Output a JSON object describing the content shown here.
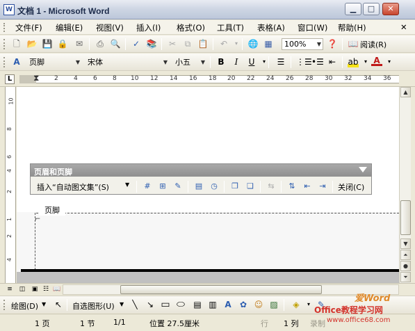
{
  "window": {
    "app_icon": "W",
    "title": "文档 1 - Microsoft Word",
    "minimize": "▁",
    "maximize": "□",
    "close": "✕"
  },
  "menubar": {
    "items": [
      {
        "label": "文件(F)"
      },
      {
        "label": "编辑(E)"
      },
      {
        "label": "视图(V)"
      },
      {
        "label": "插入(I)"
      },
      {
        "label": "格式(O)"
      },
      {
        "label": "工具(T)"
      },
      {
        "label": "表格(A)"
      },
      {
        "label": "窗口(W)"
      },
      {
        "label": "帮助(H)"
      }
    ],
    "close_doc": "✕"
  },
  "standard_toolbar": {
    "zoom": "100%",
    "read_label": "阅读(R)"
  },
  "format_toolbar": {
    "style": "页脚",
    "font": "宋体",
    "size": "小五",
    "bold": "B",
    "italic": "I",
    "underline": "U",
    "style_icon": "A"
  },
  "ruler": {
    "tab_selector": "L",
    "ticks": [
      "2",
      "4",
      "6",
      "8",
      "10",
      "12",
      "14",
      "16",
      "18",
      "20",
      "22",
      "24",
      "26",
      "28",
      "30",
      "32",
      "34",
      "36"
    ],
    "vticks": [
      "10",
      "8",
      "6",
      "4",
      "2",
      "1",
      "2",
      "4"
    ]
  },
  "header_footer_toolbar": {
    "title": "页眉和页脚",
    "insert_autotext": "插入“自动图文集”(S)",
    "close": "关闭(C)"
  },
  "document": {
    "footer_label": "页脚"
  },
  "drawing_toolbar": {
    "draw": "绘图(D)",
    "autoshapes": "自选图形(U)"
  },
  "statusbar": {
    "page": "1 页",
    "section": "1 节",
    "page_of": "1/1",
    "position": "位置 27.5厘米",
    "line": "行",
    "column": "1 列",
    "record": "录制"
  },
  "watermark": {
    "line1": "爱Word",
    "line2": "Office教程学习网",
    "line3": "www.office68.com"
  }
}
